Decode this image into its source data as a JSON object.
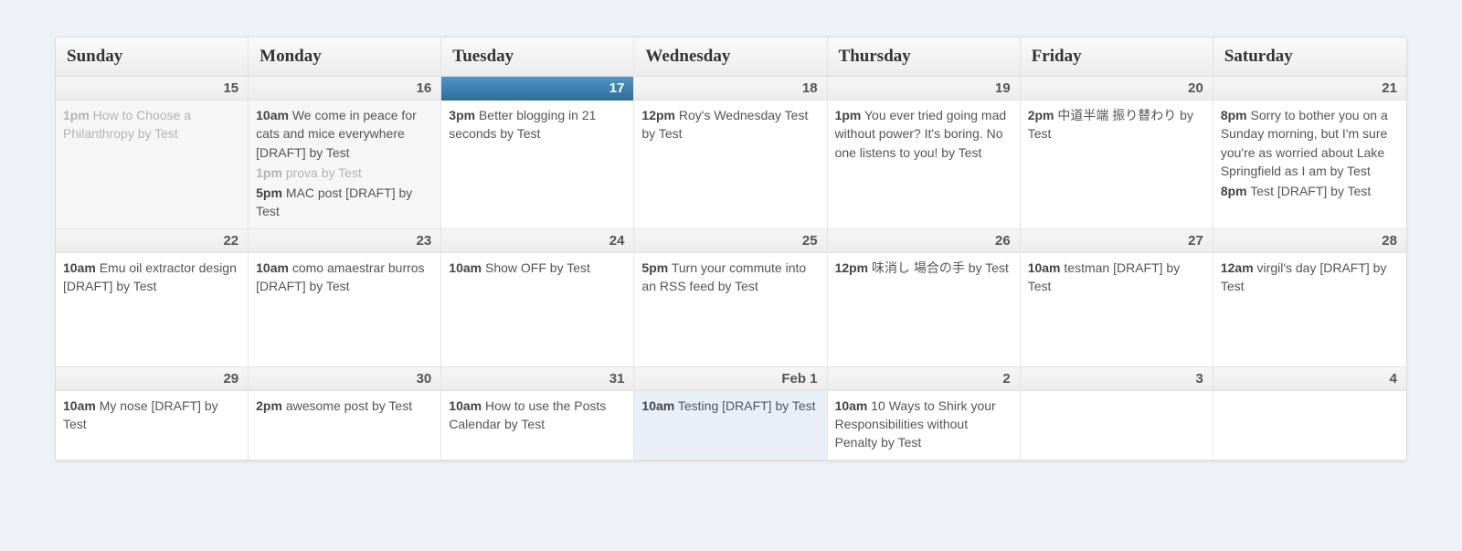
{
  "day_headers": [
    "Sunday",
    "Monday",
    "Tuesday",
    "Wednesday",
    "Thursday",
    "Friday",
    "Saturday"
  ],
  "weeks": [
    [
      {
        "date": "15",
        "past": true,
        "events": [
          {
            "time": "1pm",
            "text": "How to Choose a Philanthropy by Test",
            "muted": true
          }
        ]
      },
      {
        "date": "16",
        "past": true,
        "events": [
          {
            "time": "10am",
            "text": "We come in peace for cats and mice everywhere [DRAFT] by Test"
          },
          {
            "time": "1pm",
            "text": "prova by Test",
            "muted": true
          },
          {
            "time": "5pm",
            "text": "MAC post [DRAFT] by Test"
          }
        ]
      },
      {
        "date": "17",
        "today": true,
        "events": [
          {
            "time": "3pm",
            "text": "Better blogging in 21 seconds by Test"
          }
        ]
      },
      {
        "date": "18",
        "events": [
          {
            "time": "12pm",
            "text": "Roy's Wednesday Test by Test"
          }
        ]
      },
      {
        "date": "19",
        "events": [
          {
            "time": "1pm",
            "text": "You ever tried going mad without power? It's boring. No one listens to you! by Test"
          }
        ]
      },
      {
        "date": "20",
        "events": [
          {
            "time": "2pm",
            "text": "中道半端 振り替わり by Test"
          }
        ]
      },
      {
        "date": "21",
        "events": [
          {
            "time": "8pm",
            "text": "Sorry to bother you on a Sunday morning, but I'm sure you're as worried about Lake Springfield as I am by Test"
          },
          {
            "time": "8pm",
            "text": "Test [DRAFT] by Test"
          }
        ]
      }
    ],
    [
      {
        "date": "22",
        "events": [
          {
            "time": "10am",
            "text": "Emu oil extractor design [DRAFT] by Test"
          }
        ]
      },
      {
        "date": "23",
        "events": [
          {
            "time": "10am",
            "text": "como amaestrar burros [DRAFT] by Test"
          }
        ]
      },
      {
        "date": "24",
        "events": [
          {
            "time": "10am",
            "text": "Show OFF by Test"
          }
        ]
      },
      {
        "date": "25",
        "events": [
          {
            "time": "5pm",
            "text": "Turn your commute into an RSS feed by Test"
          }
        ]
      },
      {
        "date": "26",
        "events": [
          {
            "time": "12pm",
            "text": "味消し 場合の手 by Test"
          }
        ]
      },
      {
        "date": "27",
        "events": [
          {
            "time": "10am",
            "text": "testman [DRAFT] by Test"
          }
        ]
      },
      {
        "date": "28",
        "events": [
          {
            "time": "12am",
            "text": "virgil's day [DRAFT] by Test"
          }
        ]
      }
    ],
    [
      {
        "date": "29",
        "events": [
          {
            "time": "10am",
            "text": "My nose [DRAFT] by Test"
          }
        ]
      },
      {
        "date": "30",
        "events": [
          {
            "time": "2pm",
            "text": "awesome post by Test"
          }
        ]
      },
      {
        "date": "31",
        "events": [
          {
            "time": "10am",
            "text": "How to use the Posts Calendar by Test"
          }
        ]
      },
      {
        "date": "Feb 1",
        "highlight": true,
        "events": [
          {
            "time": "10am",
            "text": "Testing [DRAFT] by Test"
          }
        ]
      },
      {
        "date": "2",
        "events": [
          {
            "time": "10am",
            "text": "10 Ways to Shirk your Responsibilities without Penalty by Test"
          }
        ]
      },
      {
        "date": "3",
        "events": []
      },
      {
        "date": "4",
        "events": []
      }
    ]
  ]
}
